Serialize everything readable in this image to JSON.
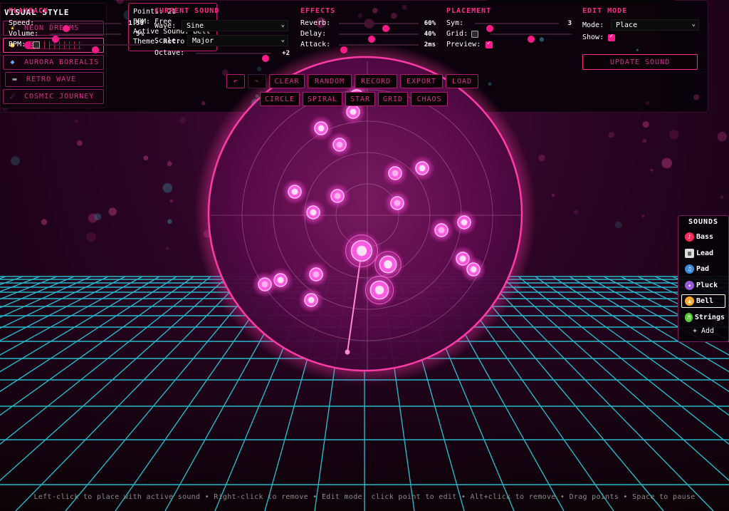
{
  "style_menu": {
    "title": "VISUAL STYLE",
    "items": [
      {
        "label": "NEON DREAMS",
        "icon": "star-icon",
        "glyph": "★",
        "color": "#ffd23a"
      },
      {
        "label": "S██████████S",
        "icon": "person-icon",
        "glyph": "👤",
        "color": "#ffcc33"
      },
      {
        "label": "AURORA BOREALIS",
        "icon": "gem-icon",
        "glyph": "◆",
        "color": "#66aaff"
      },
      {
        "label": "RETRO WAVE",
        "icon": "gamepad-icon",
        "glyph": "🎮",
        "color": "#8899aa"
      },
      {
        "label": "COSMIC JOURNEY",
        "icon": "comet-icon",
        "glyph": "☄",
        "color": "#88aaff"
      }
    ]
  },
  "info": {
    "points": "Points: 21",
    "bpm": "BPM: Free",
    "active_sound": "Active Sound: Bell",
    "theme": "Theme: Retro Wave"
  },
  "sounds": {
    "title": "SOUNDS",
    "items": [
      {
        "label": "Bass",
        "icon": "bass-icon",
        "color": "#ff2a5a"
      },
      {
        "label": "Lead",
        "icon": "piano-icon",
        "color": "#dddddd"
      },
      {
        "label": "Pad",
        "icon": "pad-icon",
        "color": "#3a8ad8"
      },
      {
        "label": "Pluck",
        "icon": "pluck-icon",
        "color": "#9a5ad8"
      },
      {
        "label": "Bell",
        "icon": "bell-icon",
        "color": "#ffaa2a"
      },
      {
        "label": "Strings",
        "icon": "strings-icon",
        "color": "#5ac83a"
      }
    ],
    "add_label": "+ Add",
    "active": "Bell"
  },
  "playback": {
    "title": "PLAYBACK",
    "speed_label": "Speed:",
    "speed_value": "1.50",
    "speed_pos": 0.2,
    "volume_label": "Volume:",
    "volume_value": "5%",
    "volume_pos": 0.03,
    "bpm_label": "BPM:",
    "bpm_checked": false,
    "bpm_pos": 0.5
  },
  "current_sound": {
    "title": "CURRENT SOUND",
    "wave_label": "Wave:",
    "wave_value": "Sine",
    "scale_label": "Scale:",
    "scale_value": "Major",
    "octave_label": "Octave:",
    "octave_value": "+2",
    "octave_pos": 0.97
  },
  "effects": {
    "title": "EFFECTS",
    "reverb_label": "Reverb:",
    "reverb_value": "60%",
    "reverb_pos": 0.6,
    "delay_label": "Delay:",
    "delay_value": "40%",
    "delay_pos": 0.4,
    "attack_label": "Attack:",
    "attack_value": "2ms",
    "attack_pos": 0.02
  },
  "placement": {
    "title": "PLACEMENT",
    "sym_label": "Sym:",
    "sym_value": "3",
    "sym_pos": 0.15,
    "grid_label": "Grid:",
    "grid_checked": false,
    "grid_pos": 0.5,
    "preview_label": "Preview:",
    "preview_checked": true
  },
  "edit_mode": {
    "title": "EDIT MODE",
    "mode_label": "Mode:",
    "mode_value": "Place",
    "show_label": "Show:",
    "show_checked": true,
    "update_label": "UPDATE SOUND"
  },
  "toolbar": {
    "undo": "↶",
    "redo": "↷",
    "clear": "CLEAR",
    "random": "RANDOM",
    "record": "RECORD",
    "export": "EXPORT",
    "load": "LOAD"
  },
  "patterns": {
    "circle": "CIRCLE",
    "spiral": "SPIRAL",
    "star": "STAR",
    "grid": "GRID",
    "chaos": "CHAOS"
  },
  "help": "Left-click to place with active sound • Right-click to remove • Edit mode: click point to edit • Alt+click to remove • Drag points • Space to pause",
  "colors": {
    "accent": "#ff2a8a",
    "grid": "#2ad8e8",
    "orb_edge": "#ff3aa8",
    "node": "#ff5ae0"
  }
}
